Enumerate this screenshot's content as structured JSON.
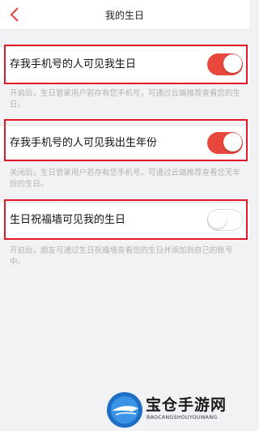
{
  "header": {
    "title": "我的生日",
    "back_icon": "chevron-left-icon"
  },
  "settings": [
    {
      "label": "存我手机号的人可见我生日",
      "enabled": true,
      "description": "开启后，生日管家用户若存有您手机号，可通过云端推荐查看您的生日。"
    },
    {
      "label": "存我手机号的人可见我出生年份",
      "enabled": true,
      "description": "关闭后，生日管家用户若存有您手机号，可通过云端推荐查看您无年份的生日。"
    },
    {
      "label": "生日祝福墙可见我的生日",
      "enabled": false,
      "description": "开启后，朋友可通过生日祝福墙查看您的生日并添加到自己的账号中。"
    }
  ],
  "watermark": {
    "name": "宝仓手游网",
    "subtitle": "BAOCANGSHOUYOUWANG"
  },
  "colors": {
    "accent": "#e8473d",
    "highlight_border": "#e0182a",
    "description_text": "#b2b2b2",
    "background": "#f2f2f4"
  }
}
